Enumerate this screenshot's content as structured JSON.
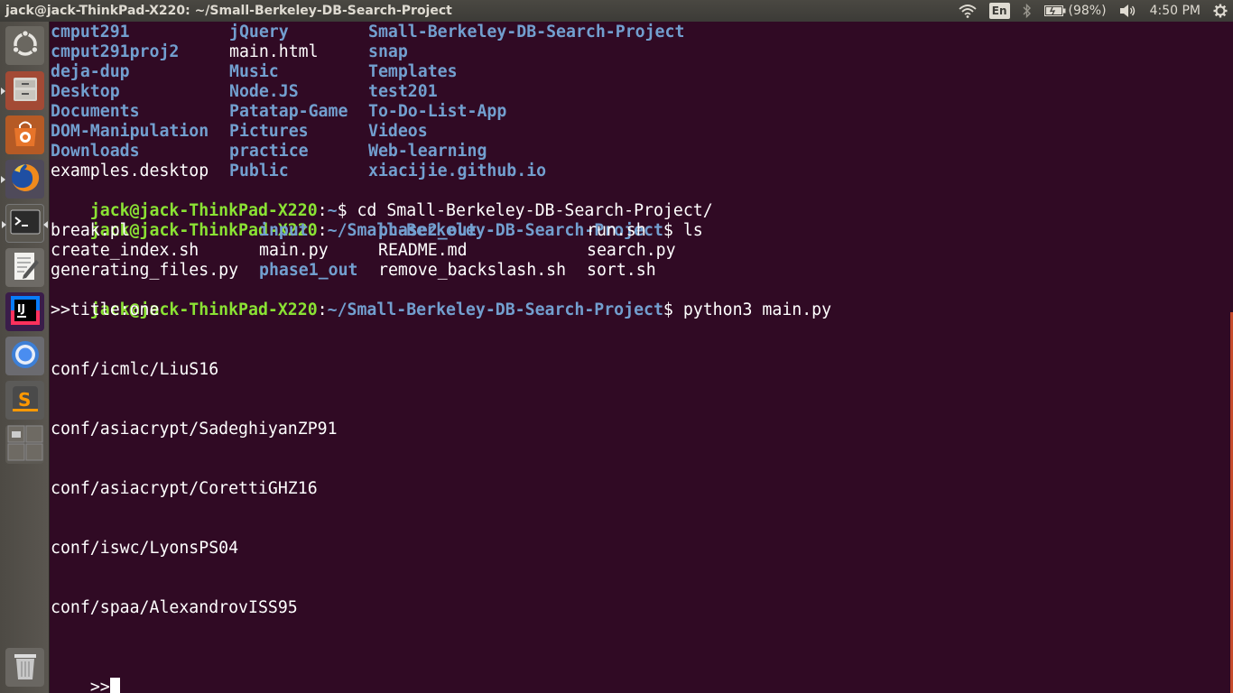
{
  "window": {
    "title": "jack@jack-ThinkPad-X220: ~/Small-Berkeley-DB-Search-Project"
  },
  "tray": {
    "wifi_icon": "wifi-icon",
    "language": "En",
    "bluetooth_icon": "bluetooth-icon",
    "battery": "(98%)",
    "volume_icon": "volume-icon",
    "clock": "4:50 PM",
    "settings_icon": "gear-icon"
  },
  "launcher": {
    "items": [
      {
        "name": "dash-home",
        "icon": "ubuntu-icon"
      },
      {
        "name": "files",
        "icon": "file-cabinet-icon"
      },
      {
        "name": "software-center",
        "icon": "shopping-bag-icon"
      },
      {
        "name": "firefox",
        "icon": "firefox-icon"
      },
      {
        "name": "terminal",
        "icon": "terminal-icon"
      },
      {
        "name": "text-editor",
        "icon": "text-editor-icon"
      },
      {
        "name": "intellij",
        "icon": "intellij-icon"
      },
      {
        "name": "chromium",
        "icon": "chromium-icon"
      },
      {
        "name": "sublime",
        "icon": "sublime-icon"
      },
      {
        "name": "workspaces",
        "icon": "workspace-switcher-icon"
      },
      {
        "name": "trash",
        "icon": "trash-icon"
      }
    ]
  },
  "terminal": {
    "home_listing": [
      [
        {
          "t": "cmput291",
          "k": "dir"
        },
        {
          "t": "jQuery",
          "k": "dir"
        },
        {
          "t": "Small-Berkeley-DB-Search-Project",
          "k": "dir"
        }
      ],
      [
        {
          "t": "cmput291proj2",
          "k": "dir"
        },
        {
          "t": "main.html",
          "k": "file"
        },
        {
          "t": "snap",
          "k": "dir"
        }
      ],
      [
        {
          "t": "deja-dup",
          "k": "dir"
        },
        {
          "t": "Music",
          "k": "dir"
        },
        {
          "t": "Templates",
          "k": "dir"
        }
      ],
      [
        {
          "t": "Desktop",
          "k": "dir"
        },
        {
          "t": "Node.JS",
          "k": "dir"
        },
        {
          "t": "test201",
          "k": "dir"
        }
      ],
      [
        {
          "t": "Documents",
          "k": "dir"
        },
        {
          "t": "Patatap-Game",
          "k": "dir"
        },
        {
          "t": "To-Do-List-App",
          "k": "dir"
        }
      ],
      [
        {
          "t": "DOM-Manipulation",
          "k": "dir"
        },
        {
          "t": "Pictures",
          "k": "dir"
        },
        {
          "t": "Videos",
          "k": "dir"
        }
      ],
      [
        {
          "t": "Downloads",
          "k": "dir"
        },
        {
          "t": "practice",
          "k": "dir"
        },
        {
          "t": "Web-learning",
          "k": "dir"
        }
      ],
      [
        {
          "t": "examples.desktop",
          "k": "file"
        },
        {
          "t": "Public",
          "k": "dir"
        },
        {
          "t": "xiacijie.github.io",
          "k": "dir"
        }
      ]
    ],
    "prompt_user": "jack@jack-ThinkPad-X220",
    "prompt_sep": ":",
    "prompt1_path": "~",
    "prompt1_dollar": "$ ",
    "cmd1": "cd Small-Berkeley-DB-Search-Project/",
    "prompt2_path": "~/Small-Berkeley-DB-Search-Project",
    "prompt2_dollar": "$ ",
    "cmd2": "ls",
    "project_listing": [
      [
        {
          "t": "break.pl",
          "k": "file"
        },
        {
          "t": "input",
          "k": "dir"
        },
        {
          "t": "phase2_out",
          "k": "dir"
        },
        {
          "t": "run.sh",
          "k": "file"
        }
      ],
      [
        {
          "t": "create_index.sh",
          "k": "file"
        },
        {
          "t": "main.py",
          "k": "file"
        },
        {
          "t": "README.md",
          "k": "file"
        },
        {
          "t": "search.py",
          "k": "file"
        }
      ],
      [
        {
          "t": "generating_files.py",
          "k": "file"
        },
        {
          "t": "phase1_out",
          "k": "dir"
        },
        {
          "t": "remove_backslash.sh",
          "k": "file"
        },
        {
          "t": "sort.sh",
          "k": "file"
        }
      ]
    ],
    "prompt3_path": "~/Small-Berkeley-DB-Search-Project",
    "prompt3_dollar": "$ ",
    "cmd3": "python3 main.py",
    "query_line": ">>title:one",
    "results": [
      "conf/icmlc/LiuS16",
      "conf/asiacrypt/SadeghiyanZP91",
      "conf/asiacrypt/CorettiGHZ16",
      "conf/iswc/LyonsPS04",
      "conf/spaa/AlexandrovISS95"
    ],
    "input_prompt": ">>"
  }
}
